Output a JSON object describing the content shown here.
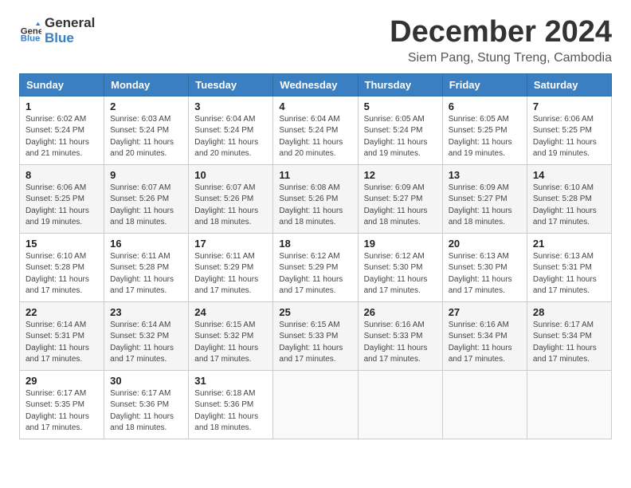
{
  "logo": {
    "general": "General",
    "blue": "Blue"
  },
  "title": "December 2024",
  "subtitle": "Siem Pang, Stung Treng, Cambodia",
  "days_header": [
    "Sunday",
    "Monday",
    "Tuesday",
    "Wednesday",
    "Thursday",
    "Friday",
    "Saturday"
  ],
  "weeks": [
    [
      {
        "day": "1",
        "info": "Sunrise: 6:02 AM\nSunset: 5:24 PM\nDaylight: 11 hours\nand 21 minutes."
      },
      {
        "day": "2",
        "info": "Sunrise: 6:03 AM\nSunset: 5:24 PM\nDaylight: 11 hours\nand 20 minutes."
      },
      {
        "day": "3",
        "info": "Sunrise: 6:04 AM\nSunset: 5:24 PM\nDaylight: 11 hours\nand 20 minutes."
      },
      {
        "day": "4",
        "info": "Sunrise: 6:04 AM\nSunset: 5:24 PM\nDaylight: 11 hours\nand 20 minutes."
      },
      {
        "day": "5",
        "info": "Sunrise: 6:05 AM\nSunset: 5:24 PM\nDaylight: 11 hours\nand 19 minutes."
      },
      {
        "day": "6",
        "info": "Sunrise: 6:05 AM\nSunset: 5:25 PM\nDaylight: 11 hours\nand 19 minutes."
      },
      {
        "day": "7",
        "info": "Sunrise: 6:06 AM\nSunset: 5:25 PM\nDaylight: 11 hours\nand 19 minutes."
      }
    ],
    [
      {
        "day": "8",
        "info": "Sunrise: 6:06 AM\nSunset: 5:25 PM\nDaylight: 11 hours\nand 19 minutes."
      },
      {
        "day": "9",
        "info": "Sunrise: 6:07 AM\nSunset: 5:26 PM\nDaylight: 11 hours\nand 18 minutes."
      },
      {
        "day": "10",
        "info": "Sunrise: 6:07 AM\nSunset: 5:26 PM\nDaylight: 11 hours\nand 18 minutes."
      },
      {
        "day": "11",
        "info": "Sunrise: 6:08 AM\nSunset: 5:26 PM\nDaylight: 11 hours\nand 18 minutes."
      },
      {
        "day": "12",
        "info": "Sunrise: 6:09 AM\nSunset: 5:27 PM\nDaylight: 11 hours\nand 18 minutes."
      },
      {
        "day": "13",
        "info": "Sunrise: 6:09 AM\nSunset: 5:27 PM\nDaylight: 11 hours\nand 18 minutes."
      },
      {
        "day": "14",
        "info": "Sunrise: 6:10 AM\nSunset: 5:28 PM\nDaylight: 11 hours\nand 17 minutes."
      }
    ],
    [
      {
        "day": "15",
        "info": "Sunrise: 6:10 AM\nSunset: 5:28 PM\nDaylight: 11 hours\nand 17 minutes."
      },
      {
        "day": "16",
        "info": "Sunrise: 6:11 AM\nSunset: 5:28 PM\nDaylight: 11 hours\nand 17 minutes."
      },
      {
        "day": "17",
        "info": "Sunrise: 6:11 AM\nSunset: 5:29 PM\nDaylight: 11 hours\nand 17 minutes."
      },
      {
        "day": "18",
        "info": "Sunrise: 6:12 AM\nSunset: 5:29 PM\nDaylight: 11 hours\nand 17 minutes."
      },
      {
        "day": "19",
        "info": "Sunrise: 6:12 AM\nSunset: 5:30 PM\nDaylight: 11 hours\nand 17 minutes."
      },
      {
        "day": "20",
        "info": "Sunrise: 6:13 AM\nSunset: 5:30 PM\nDaylight: 11 hours\nand 17 minutes."
      },
      {
        "day": "21",
        "info": "Sunrise: 6:13 AM\nSunset: 5:31 PM\nDaylight: 11 hours\nand 17 minutes."
      }
    ],
    [
      {
        "day": "22",
        "info": "Sunrise: 6:14 AM\nSunset: 5:31 PM\nDaylight: 11 hours\nand 17 minutes."
      },
      {
        "day": "23",
        "info": "Sunrise: 6:14 AM\nSunset: 5:32 PM\nDaylight: 11 hours\nand 17 minutes."
      },
      {
        "day": "24",
        "info": "Sunrise: 6:15 AM\nSunset: 5:32 PM\nDaylight: 11 hours\nand 17 minutes."
      },
      {
        "day": "25",
        "info": "Sunrise: 6:15 AM\nSunset: 5:33 PM\nDaylight: 11 hours\nand 17 minutes."
      },
      {
        "day": "26",
        "info": "Sunrise: 6:16 AM\nSunset: 5:33 PM\nDaylight: 11 hours\nand 17 minutes."
      },
      {
        "day": "27",
        "info": "Sunrise: 6:16 AM\nSunset: 5:34 PM\nDaylight: 11 hours\nand 17 minutes."
      },
      {
        "day": "28",
        "info": "Sunrise: 6:17 AM\nSunset: 5:34 PM\nDaylight: 11 hours\nand 17 minutes."
      }
    ],
    [
      {
        "day": "29",
        "info": "Sunrise: 6:17 AM\nSunset: 5:35 PM\nDaylight: 11 hours\nand 17 minutes."
      },
      {
        "day": "30",
        "info": "Sunrise: 6:17 AM\nSunset: 5:36 PM\nDaylight: 11 hours\nand 18 minutes."
      },
      {
        "day": "31",
        "info": "Sunrise: 6:18 AM\nSunset: 5:36 PM\nDaylight: 11 hours\nand 18 minutes."
      },
      {
        "day": "",
        "info": ""
      },
      {
        "day": "",
        "info": ""
      },
      {
        "day": "",
        "info": ""
      },
      {
        "day": "",
        "info": ""
      }
    ]
  ]
}
